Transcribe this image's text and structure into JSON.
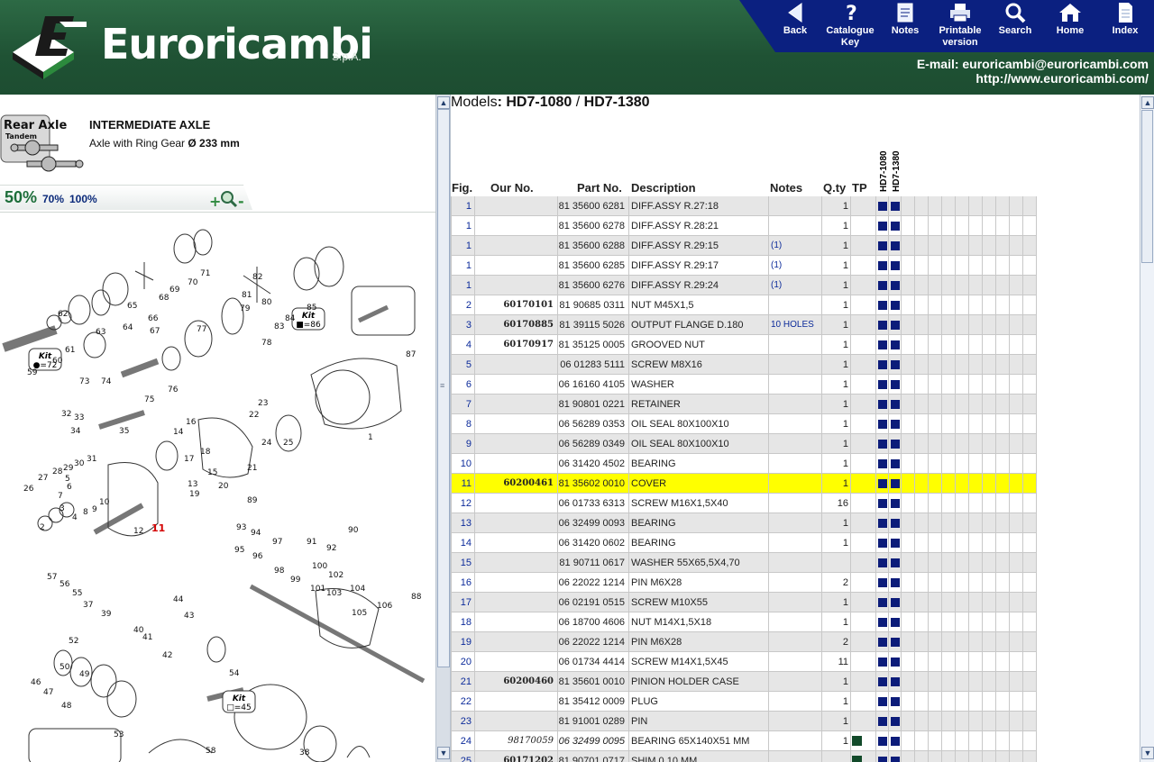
{
  "header": {
    "brand": "Euroricambi",
    "brand_suffix": "S.p.A.",
    "email": "E-mail: euroricambi@euroricambi.com",
    "url": "http://www.euroricambi.com/",
    "nav": [
      {
        "label": "Back",
        "icon": "back-arrow-icon"
      },
      {
        "label": "Catalogue Key",
        "icon": "question-icon"
      },
      {
        "label": "Notes",
        "icon": "notepad-icon"
      },
      {
        "label": "Printable version",
        "icon": "printer-icon"
      },
      {
        "label": "Search",
        "icon": "magnifier-icon"
      },
      {
        "label": "Home",
        "icon": "home-icon"
      },
      {
        "label": "Index",
        "icon": "document-icon"
      }
    ]
  },
  "left": {
    "badge_title": "Rear Axle",
    "badge_sub": "Tandem",
    "title": "INTERMEDIATE AXLE",
    "subtitle_prefix": "Axle with Ring Gear ",
    "subtitle_value": "Ø 233 mm",
    "zoom": [
      "50%",
      "70%",
      "100%"
    ],
    "kits": [
      "Kit ■=86",
      "Kit ●=72",
      "Kit □=45"
    ],
    "highlight_callout": "11"
  },
  "models": {
    "prefix": "Models",
    "a": "HD7-1080",
    "sep": " / ",
    "b": "HD7-1380"
  },
  "columns": {
    "fig": "Fig.",
    "our": "Our No.",
    "part": "Part No.",
    "desc": "Description",
    "notes": "Notes",
    "qty": "Q.ty",
    "tp": "TP",
    "model1": "HD7-1080",
    "model2": "HD7-1380"
  },
  "rows": [
    {
      "fig": "1",
      "our": "",
      "part": "81 35600 6281",
      "desc": "DIFF.ASSY R.27:18",
      "notes": "",
      "qty": "1"
    },
    {
      "fig": "1",
      "our": "",
      "part": "81 35600 6278",
      "desc": "DIFF.ASSY R.28:21",
      "notes": "",
      "qty": "1"
    },
    {
      "fig": "1",
      "our": "",
      "part": "81 35600 6288",
      "desc": "DIFF.ASSY R.29:15",
      "notes": "(1)",
      "qty": "1"
    },
    {
      "fig": "1",
      "our": "",
      "part": "81 35600 6285",
      "desc": "DIFF.ASSY R.29:17",
      "notes": "(1)",
      "qty": "1"
    },
    {
      "fig": "1",
      "our": "",
      "part": "81 35600 6276",
      "desc": "DIFF.ASSY R.29:24",
      "notes": "(1)",
      "qty": "1"
    },
    {
      "fig": "2",
      "our": "60170101",
      "part": "81 90685 0311",
      "desc": "NUT M45X1,5",
      "notes": "",
      "qty": "1"
    },
    {
      "fig": "3",
      "our": "60170885",
      "part": "81 39115 5026",
      "desc": "OUTPUT FLANGE D.180",
      "notes": "10 HOLES",
      "qty": "1"
    },
    {
      "fig": "4",
      "our": "60170917",
      "part": "81 35125 0005",
      "desc": "GROOVED NUT",
      "notes": "",
      "qty": "1"
    },
    {
      "fig": "5",
      "our": "",
      "part": "06 01283 5111",
      "desc": "SCREW M8X16",
      "notes": "",
      "qty": "1"
    },
    {
      "fig": "6",
      "our": "",
      "part": "06 16160 4105",
      "desc": "WASHER",
      "notes": "",
      "qty": "1"
    },
    {
      "fig": "7",
      "our": "",
      "part": "81 90801 0221",
      "desc": "RETAINER",
      "notes": "",
      "qty": "1"
    },
    {
      "fig": "8",
      "our": "",
      "part": "06 56289 0353",
      "desc": "OIL SEAL 80X100X10",
      "notes": "",
      "qty": "1"
    },
    {
      "fig": "9",
      "our": "",
      "part": "06 56289 0349",
      "desc": "OIL SEAL 80X100X10",
      "notes": "",
      "qty": "1"
    },
    {
      "fig": "10",
      "our": "",
      "part": "06 31420 4502",
      "desc": "BEARING",
      "notes": "",
      "qty": "1"
    },
    {
      "fig": "11",
      "our": "60200461",
      "part": "81 35602 0010",
      "desc": "COVER",
      "notes": "",
      "qty": "1",
      "highlight": true
    },
    {
      "fig": "12",
      "our": "",
      "part": "06 01733 6313",
      "desc": "SCREW M16X1,5X40",
      "notes": "",
      "qty": "16"
    },
    {
      "fig": "13",
      "our": "",
      "part": "06 32499 0093",
      "desc": "BEARING",
      "notes": "",
      "qty": "1"
    },
    {
      "fig": "14",
      "our": "",
      "part": "06 31420 0602",
      "desc": "BEARING",
      "notes": "",
      "qty": "1"
    },
    {
      "fig": "15",
      "our": "",
      "part": "81 90711 0617",
      "desc": "WASHER 55X65,5X4,70",
      "notes": "",
      "qty": ""
    },
    {
      "fig": "16",
      "our": "",
      "part": "06 22022 1214",
      "desc": "PIN M6X28",
      "notes": "",
      "qty": "2"
    },
    {
      "fig": "17",
      "our": "",
      "part": "06 02191 0515",
      "desc": "SCREW M10X55",
      "notes": "",
      "qty": "1"
    },
    {
      "fig": "18",
      "our": "",
      "part": "06 18700 4606",
      "desc": "NUT M14X1,5X18",
      "notes": "",
      "qty": "1"
    },
    {
      "fig": "19",
      "our": "",
      "part": "06 22022 1214",
      "desc": "PIN M6X28",
      "notes": "",
      "qty": "2"
    },
    {
      "fig": "20",
      "our": "",
      "part": "06 01734 4414",
      "desc": "SCREW M14X1,5X45",
      "notes": "",
      "qty": "11"
    },
    {
      "fig": "21",
      "our": "60200460",
      "part": "81 35601 0010",
      "desc": "PINION HOLDER CASE",
      "notes": "",
      "qty": "1"
    },
    {
      "fig": "22",
      "our": "",
      "part": "81 35412 0009",
      "desc": "PLUG",
      "notes": "",
      "qty": "1"
    },
    {
      "fig": "23",
      "our": "",
      "part": "81 91001 0289",
      "desc": "PIN",
      "notes": "",
      "qty": "1"
    },
    {
      "fig": "24",
      "our": "98170059",
      "part": "06 32499 0095",
      "desc": "BEARING 65X140X51 MM",
      "notes": "",
      "qty": "1",
      "tp": true,
      "italic": true
    },
    {
      "fig": "25",
      "our": "60171202",
      "part": "81 90701 0717",
      "desc": "SHIM 0,10 MM",
      "notes": "",
      "qty": "",
      "tp": true
    }
  ],
  "diagram_labels": [
    "59",
    "60",
    "61",
    "62",
    "63",
    "64",
    "65",
    "66",
    "67",
    "68",
    "69",
    "70",
    "71",
    "72",
    "73",
    "74",
    "75",
    "76",
    "77",
    "78",
    "79",
    "80",
    "81",
    "82",
    "83",
    "84",
    "85",
    "86",
    "87",
    "1",
    "2",
    "3",
    "4",
    "5",
    "6",
    "7",
    "8",
    "9",
    "10",
    "11",
    "12",
    "13",
    "14",
    "15",
    "16",
    "17",
    "18",
    "19",
    "20",
    "21",
    "22",
    "23",
    "24",
    "25",
    "26",
    "27",
    "28",
    "29",
    "30",
    "31",
    "32",
    "33",
    "34",
    "35",
    "36",
    "37",
    "38",
    "39",
    "40",
    "41",
    "42",
    "43",
    "44",
    "45",
    "46",
    "47",
    "48",
    "49",
    "50",
    "51",
    "52",
    "53",
    "54",
    "55",
    "56",
    "57",
    "58",
    "88",
    "89",
    "90",
    "91",
    "92",
    "93",
    "94",
    "95",
    "96",
    "97",
    "98",
    "99",
    "100",
    "101",
    "102",
    "103",
    "104",
    "105",
    "106"
  ]
}
